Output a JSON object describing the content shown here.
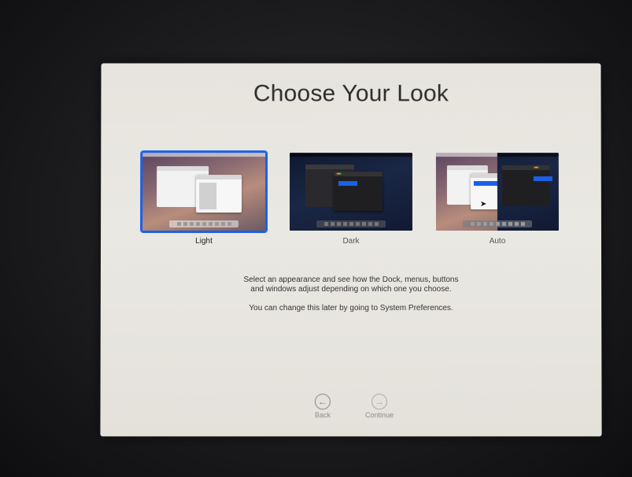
{
  "title": "Choose Your Look",
  "appearances": [
    {
      "label": "Light",
      "selected": true
    },
    {
      "label": "Dark",
      "selected": false
    },
    {
      "label": "Auto",
      "selected": false
    }
  ],
  "description": {
    "line1": "Select an appearance and see how the Dock, menus, buttons",
    "line2": "and windows adjust depending on which one you choose.",
    "note": "You can change this later by going to System Preferences."
  },
  "navigation": {
    "back_label": "Back",
    "continue_label": "Continue"
  },
  "colors": {
    "selection_accent": "#1b60e6"
  }
}
